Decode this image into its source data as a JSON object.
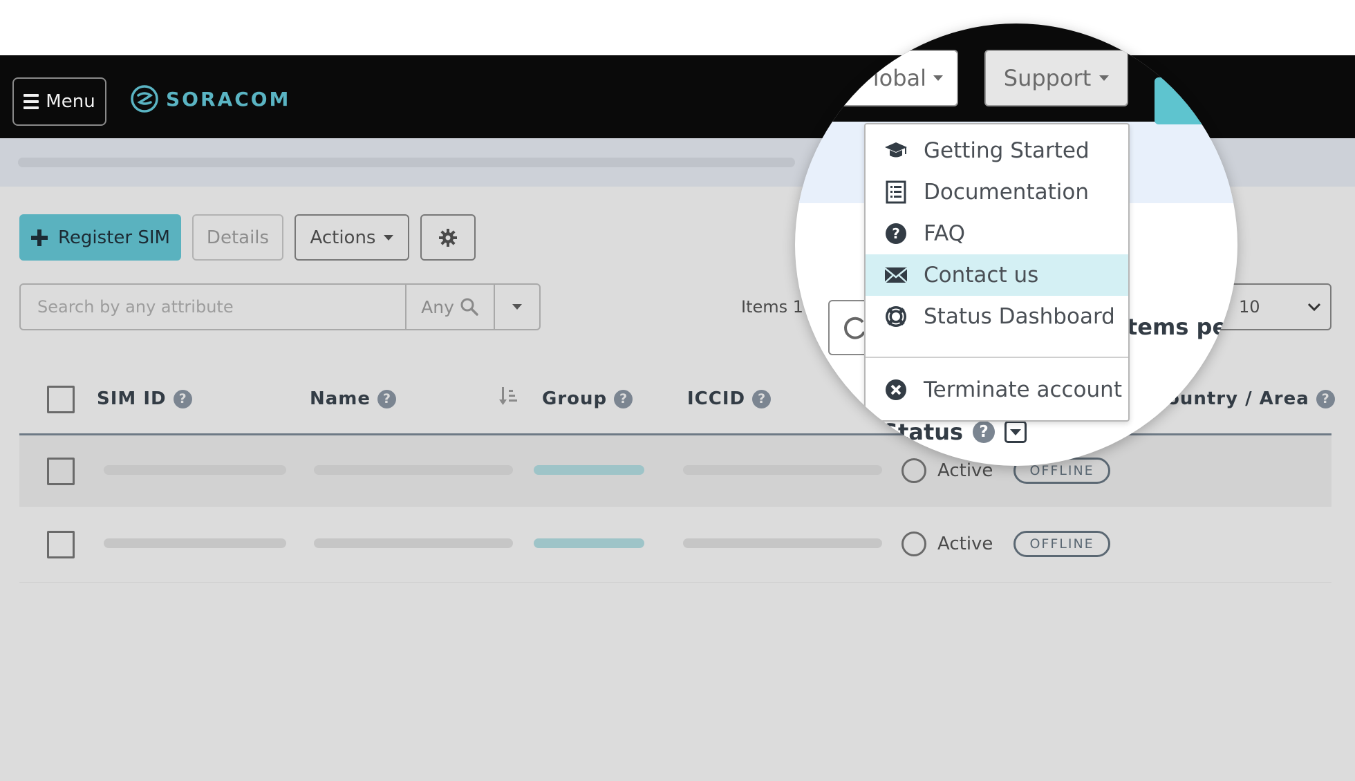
{
  "header": {
    "menu_label": "Menu",
    "brand": "SORACOM",
    "region_label": "lobal",
    "support_label": "Support"
  },
  "toolbar": {
    "register_label": "Register SIM",
    "details_label": "Details",
    "actions_label": "Actions"
  },
  "search": {
    "placeholder": "Search by any attribute",
    "any_label": "Any"
  },
  "pagination": {
    "items_label": "Items 1",
    "items_per_label": "tems per",
    "per_page_value": "10"
  },
  "table": {
    "columns": {
      "sim_id": "SIM ID",
      "name": "Name",
      "group": "Group",
      "iccid": "ICCID",
      "country": "ountry / Area",
      "status": "Status"
    },
    "rows": [
      {
        "status": "Active",
        "badge": "OFFLINE"
      },
      {
        "status": "Active",
        "badge": "OFFLINE"
      }
    ]
  },
  "support_menu": {
    "items": [
      {
        "label": "Getting Started",
        "icon": "graduation-cap-icon"
      },
      {
        "label": "Documentation",
        "icon": "list-icon"
      },
      {
        "label": "FAQ",
        "icon": "question-circle-icon"
      },
      {
        "label": "Contact us",
        "icon": "envelope-icon",
        "active": true
      },
      {
        "label": "Status Dashboard",
        "icon": "life-ring-icon"
      }
    ],
    "terminate_label": "Terminate account"
  },
  "colors": {
    "accent": "#5ab2bf",
    "navbar": "#0a0a0a",
    "highlight": "#d4f0f4"
  }
}
